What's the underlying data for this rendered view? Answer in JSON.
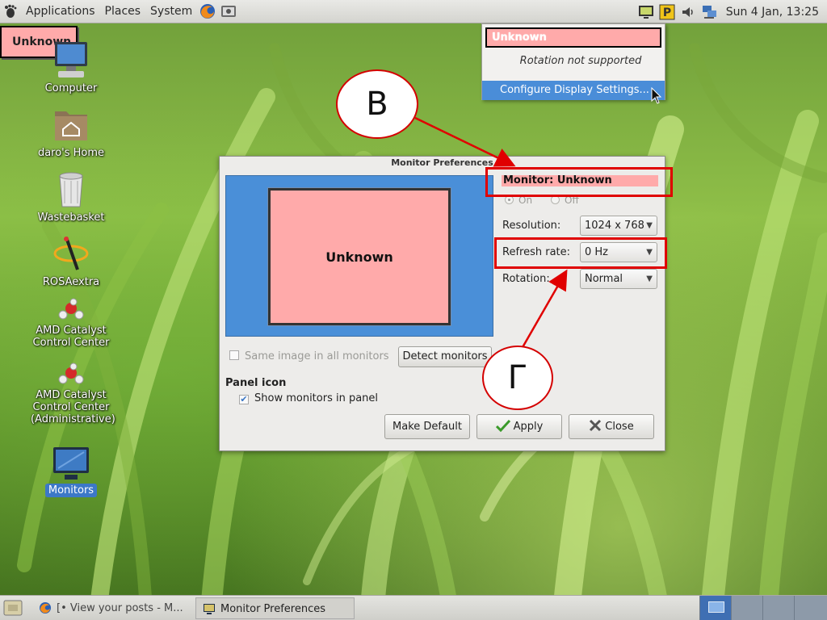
{
  "top_panel": {
    "menus": [
      "Applications",
      "Places",
      "System"
    ],
    "clock": "Sun  4 Jan, 13:25"
  },
  "desktop_icons": [
    {
      "label": "Computer",
      "icon": "computer-icon"
    },
    {
      "label": "daro's Home",
      "icon": "home-folder-icon"
    },
    {
      "label": "Wastebasket",
      "icon": "trash-icon"
    },
    {
      "label": "ROSAextra",
      "icon": "satellite-icon"
    },
    {
      "label": "AMD Catalyst Control Center",
      "icon": "amd-catalyst-icon"
    },
    {
      "label": "AMD Catalyst Control Center (Administrative)",
      "icon": "amd-catalyst-admin-icon"
    },
    {
      "label": "Monitors",
      "icon": "monitor-icon",
      "selected": true
    }
  ],
  "unknown_badge": "Unknown",
  "display_menu": {
    "monitor": "Unknown",
    "rotation": "Rotation not supported",
    "configure": "Configure Display Settings..."
  },
  "callouts": {
    "b": "B",
    "g": "Г"
  },
  "dialog": {
    "title": "Monitor Preferences",
    "preview_label": "Unknown",
    "monitor_label": "Monitor: Unknown",
    "on_label": "On",
    "off_label": "Off",
    "resolution_label": "Resolution:",
    "resolution_value": "1024 x 768",
    "refresh_label": "Refresh rate:",
    "refresh_value": "0 Hz",
    "rotation_label": "Rotation:",
    "rotation_value": "Normal",
    "same_image_label": "Same image in all monitors",
    "detect_button": "Detect monitors",
    "panel_icon_heading": "Panel icon",
    "show_monitors_label": "Show monitors in panel",
    "make_default_button": "Make Default",
    "apply_button": "Apply",
    "close_button": "Close"
  },
  "bottom_panel": {
    "tasks": [
      "[• View your posts - M...",
      "Monitor Preferences"
    ]
  },
  "colors": {
    "unknown_fill": "#ffaaaa",
    "highlight": "#4a8dd8",
    "callout_red": "#e00000"
  }
}
